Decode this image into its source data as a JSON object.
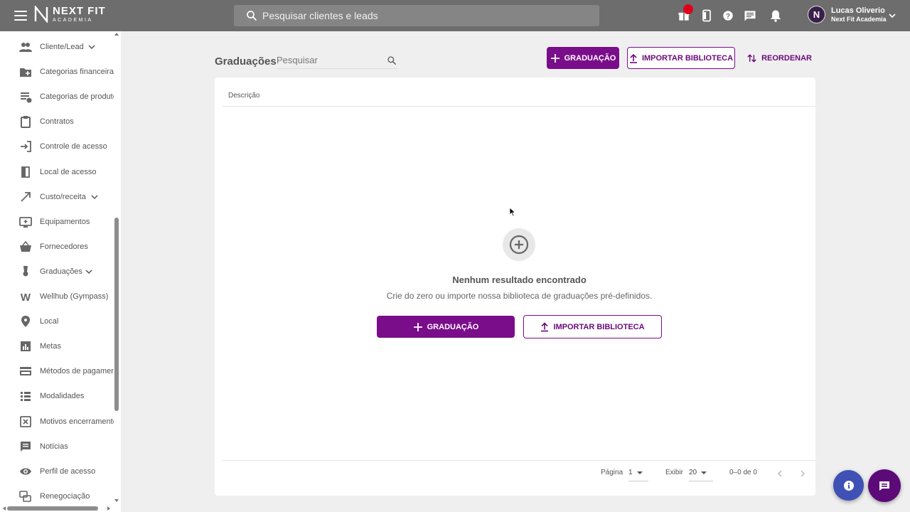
{
  "topbar": {
    "logo": {
      "name": "NEXT FIT",
      "sub": "ACADEMIA"
    },
    "search_placeholder": "Pesquisar clientes e leads",
    "icons": [
      "menu-icon",
      "gift-icon",
      "mobile-icon",
      "help-icon",
      "chat-icon",
      "bell-icon"
    ],
    "user": {
      "initial": "N",
      "name": "Lucas Oliverio",
      "org": "Next Fit Academia"
    }
  },
  "sidebar": {
    "items": [
      {
        "label": "Cliente/Lead",
        "icon": "people-icon",
        "expandable": true
      },
      {
        "label": "Categorias financeiras",
        "icon": "folder-add-icon",
        "expandable": false
      },
      {
        "label": "Categorias de produtos",
        "icon": "product-category-icon",
        "expandable": false
      },
      {
        "label": "Contratos",
        "icon": "clipboard-icon",
        "expandable": false
      },
      {
        "label": "Controle de acesso",
        "icon": "login-icon",
        "expandable": false
      },
      {
        "label": "Local de acesso",
        "icon": "door-icon",
        "expandable": false
      },
      {
        "label": "Custo/receita",
        "icon": "trend-arrow-icon",
        "expandable": true
      },
      {
        "label": "Equipamentos",
        "icon": "monitor-add-icon",
        "expandable": false
      },
      {
        "label": "Fornecedores",
        "icon": "basket-icon",
        "expandable": false
      },
      {
        "label": "Graduações",
        "icon": "medal-icon",
        "expandable": true
      },
      {
        "label": "Wellhub (Gympass)",
        "icon": "wellhub-icon",
        "expandable": false
      },
      {
        "label": "Local",
        "icon": "location-pin-icon",
        "expandable": false
      },
      {
        "label": "Metas",
        "icon": "bar-chart-icon",
        "expandable": false
      },
      {
        "label": "Métodos de pagamento",
        "icon": "credit-card-icon",
        "expandable": false
      },
      {
        "label": "Modalidades",
        "icon": "list-icon",
        "expandable": false
      },
      {
        "label": "Motivos encerramento",
        "icon": "close-box-icon",
        "expandable": false
      },
      {
        "label": "Notícias",
        "icon": "message-icon",
        "expandable": false
      },
      {
        "label": "Perfil de acesso",
        "icon": "eye-icon",
        "expandable": false
      },
      {
        "label": "Renegociação",
        "icon": "renegotiation-icon",
        "expandable": false
      }
    ]
  },
  "main": {
    "title": "Graduações",
    "search_placeholder": "Pesquisar",
    "actions": {
      "add_label": "GRADUAÇÃO",
      "import_label": "IMPORTAR BIBLIOTECA",
      "reorder_label": "REORDENAR"
    },
    "table": {
      "column": "Descrição"
    },
    "empty": {
      "title": "Nenhum resultado encontrado",
      "subtitle": "Crie do zero ou importe nossa biblioteca de graduações pré-definidos.",
      "add_label": "GRADUAÇÃO",
      "import_label": "IMPORTAR BIBLIOTECA"
    },
    "pagination": {
      "page_label": "Página",
      "page_value": "1",
      "show_label": "Exibir",
      "show_value": "20",
      "range": "0–0 de 0"
    }
  },
  "colors": {
    "topbar": "#6d6d6d",
    "primary": "#7a0d8a",
    "background": "#efefef",
    "notification": "#e0001a",
    "info_fab": "#3f51b5",
    "chat_fab": "#5c0a78"
  }
}
